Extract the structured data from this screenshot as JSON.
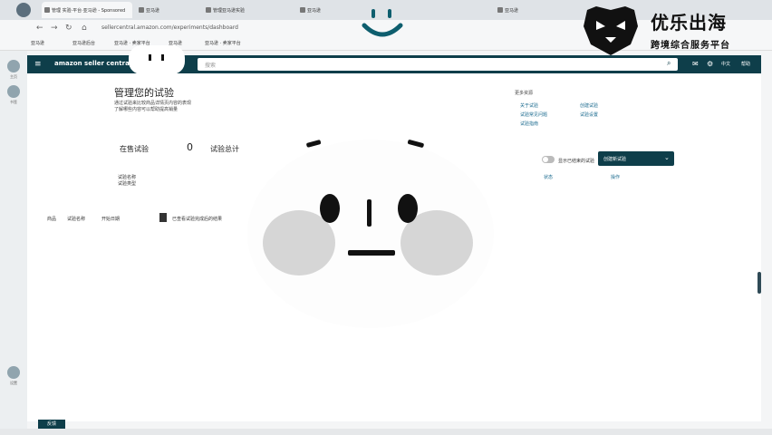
{
  "colors": {
    "nav": "#0e3e4a",
    "link": "#1a6a8e",
    "tabbar": "#dfe3e7"
  },
  "browser": {
    "tabs": [
      {
        "label": "管理 实验·平台·亚马逊 - Sponsored",
        "active": true
      },
      {
        "label": "亚马逊"
      },
      {
        "label": "管理亚马逊实验"
      },
      {
        "label": "亚马逊"
      },
      {
        "label": "亚马逊"
      }
    ],
    "url": "sellercentral.amazon.com/experiments/dashboard",
    "bookmarks": [
      "亚马逊",
      "亚马逊后台",
      "亚马逊 · 卖家平台",
      "亚马逊",
      "亚马逊 · 卖家平台"
    ]
  },
  "sidebar": {
    "labels": [
      "主页",
      "书签",
      "设置"
    ]
  },
  "amazon": {
    "logo": "amazon seller central",
    "search_placeholder": "搜索",
    "lang": "中文",
    "help": "帮助"
  },
  "page": {
    "title": "管理您的试验",
    "desc_lines": [
      "通过试验来比较商品详情页内容的表现",
      "了解哪些内容可以帮助提高销量"
    ],
    "resources_title": "更多资源",
    "resource_links": [
      "关于试验",
      "试验常见问题",
      "试验指南",
      "创建试验",
      "试验设置"
    ],
    "stats": [
      {
        "label": "在售试验",
        "value": "0"
      },
      {
        "label": "试验总计",
        "value": ""
      }
    ],
    "toggle_label": "显示已结束的试验",
    "select_value": "创建新试验",
    "filter_label": "试验名称",
    "filter_value": "试验类型",
    "col_heads": [
      "状态",
      "操作"
    ],
    "tabs": [
      "商品",
      "试验名称",
      "开始日期"
    ],
    "check_label": "已查看试验完成后的结果",
    "bottom_badge": "反馈"
  },
  "brand": {
    "title": "优乐出海",
    "subtitle": "跨境综合服务平台"
  }
}
